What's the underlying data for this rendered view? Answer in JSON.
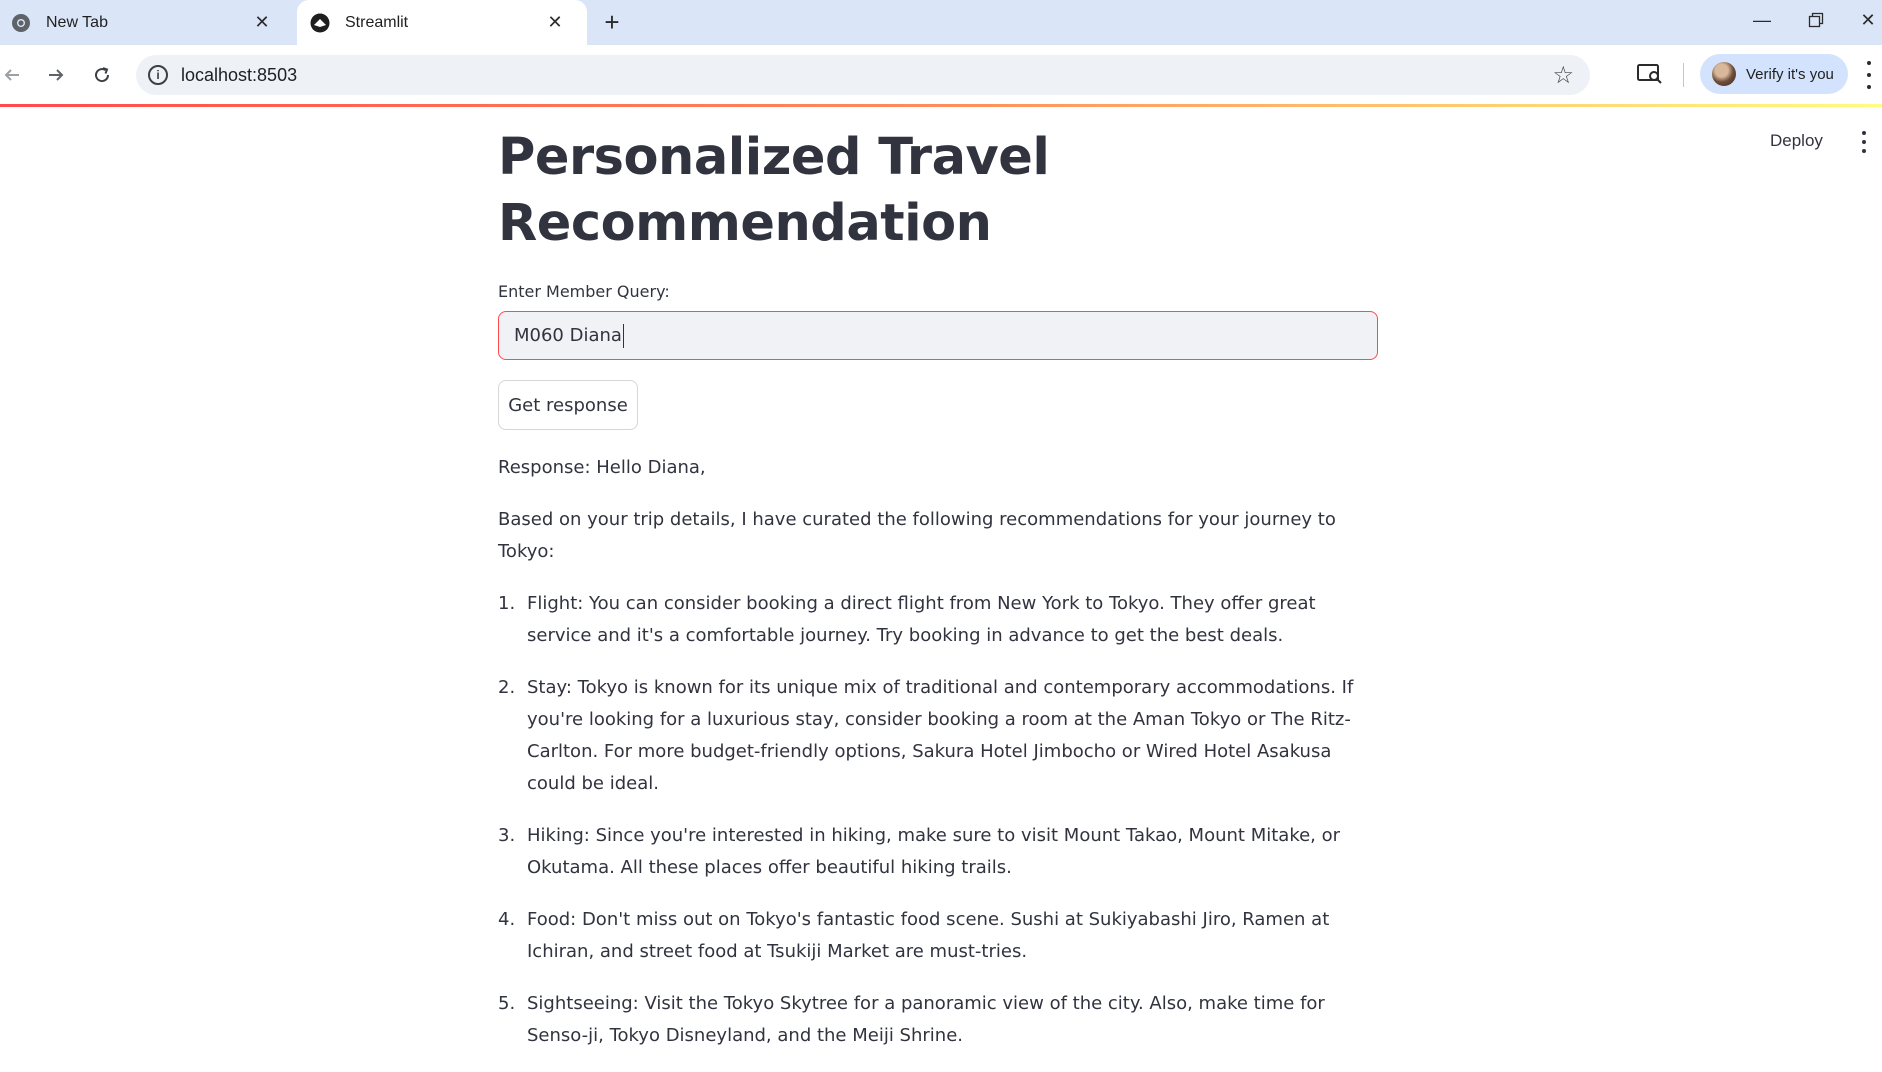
{
  "browser": {
    "tabs": [
      {
        "title": "New Tab",
        "active": false
      },
      {
        "title": "Streamlit",
        "active": true
      }
    ],
    "url": "localhost:8503",
    "profile_label": "Verify it's you",
    "accent_colors": {
      "tabbar": "#dbe5f8",
      "profile_chip": "#d3e3fd"
    }
  },
  "app": {
    "deploy_label": "Deploy",
    "title": "Personalized Travel Recommendation",
    "query_label": "Enter Member Query:",
    "query_value": "M060 Diana",
    "button_label": "Get response",
    "response": {
      "greeting": "Response: Hello Diana,",
      "intro": "Based on your trip details, I have curated the following recommendations for your journey to Tokyo:",
      "items": [
        {
          "num": "1.",
          "text": "Flight: You can consider booking a direct flight from New York to Tokyo. They offer great service and it's a comfortable journey. Try booking in advance to get the best deals."
        },
        {
          "num": "2.",
          "text": "Stay: Tokyo is known for its unique mix of traditional and contemporary accommodations. If you're looking for a luxurious stay, consider booking a room at the Aman Tokyo or The Ritz-Carlton. For more budget-friendly options, Sakura Hotel Jimbocho or Wired Hotel Asakusa could be ideal."
        },
        {
          "num": "3.",
          "text": "Hiking: Since you're interested in hiking, make sure to visit Mount Takao, Mount Mitake, or Okutama. All these places offer beautiful hiking trails."
        },
        {
          "num": "4.",
          "text": "Food: Don't miss out on Tokyo's fantastic food scene. Sushi at Sukiyabashi Jiro, Ramen at Ichiran, and street food at Tsukiji Market are must-tries."
        },
        {
          "num": "5.",
          "text": "Sightseeing: Visit the Tokyo Skytree for a panoramic view of the city. Also, make time for Senso-ji, Tokyo Disneyland, and the Meiji Shrine."
        }
      ]
    },
    "accent_color": "#ff4b4b"
  }
}
